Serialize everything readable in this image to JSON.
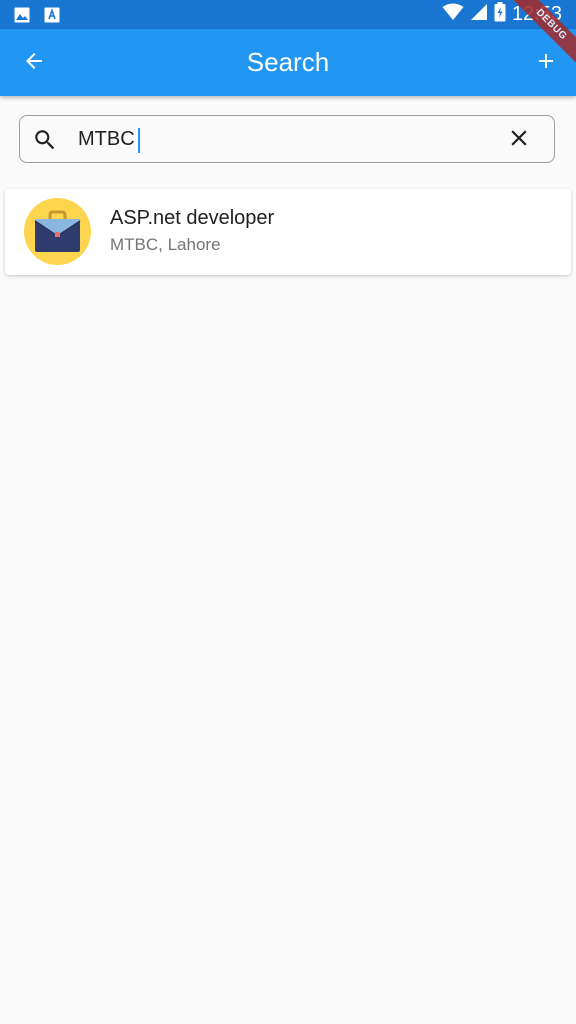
{
  "status_bar": {
    "time": "12:53",
    "icons": [
      "image-icon",
      "font-download-icon",
      "wifi-icon",
      "signal-icon",
      "battery-charging-icon"
    ],
    "color": "#1976d2"
  },
  "debug_banner": "DEBUG",
  "app_bar": {
    "title": "Search",
    "back_icon": "arrow-back-icon",
    "add_icon": "plus-icon",
    "color": "#2196f3"
  },
  "search": {
    "value": "MTBC",
    "placeholder": "",
    "search_icon": "search-icon",
    "clear_icon": "close-icon"
  },
  "results": [
    {
      "title": "ASP.net developer",
      "subtitle": "MTBC, Lahore",
      "avatar_icon": "briefcase-icon",
      "avatar_color": "#fdd54f"
    }
  ]
}
